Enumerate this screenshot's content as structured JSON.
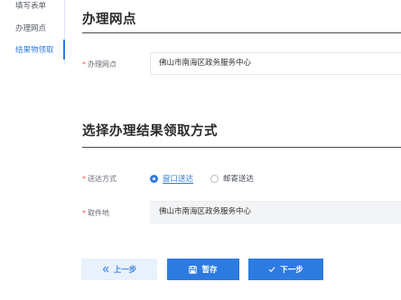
{
  "sidebar": {
    "items": [
      {
        "label": "填写表单",
        "active": false
      },
      {
        "label": "办理网点",
        "active": false
      },
      {
        "label": "结果物领取",
        "active": true
      }
    ]
  },
  "office_section": {
    "title": "办理网点",
    "field_label": "办理网点",
    "field_value": "佛山市南海区政务服务中心"
  },
  "pickup_section": {
    "title": "选择办理结果领取方式",
    "delivery_label": "送达方式",
    "options": [
      {
        "label": "窗口送达",
        "checked": true
      },
      {
        "label": "邮寄送达",
        "checked": false
      }
    ],
    "location_label": "取件地",
    "location_value": "佛山市南海区政务服务中心"
  },
  "buttons": {
    "prev_label": "上一步",
    "save_label": "暂存",
    "next_label": "下一步"
  },
  "colors": {
    "accent": "#2d7be0",
    "required": "#f05a4a",
    "prev_bg": "#e8f1fc"
  }
}
